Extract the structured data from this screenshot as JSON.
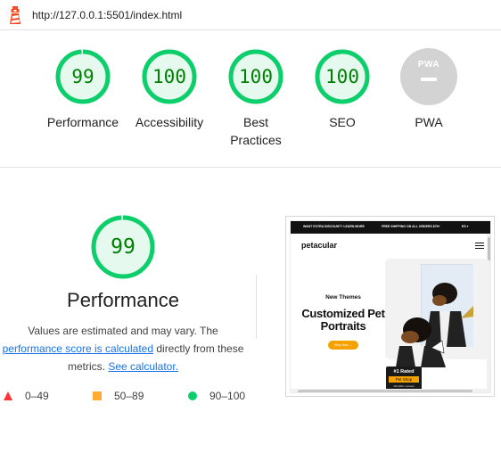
{
  "browser": {
    "url": "http://127.0.0.1:5501/index.html"
  },
  "gauges": [
    {
      "label": "Performance",
      "score": "99",
      "value": 0.99,
      "color": "#0cce6b"
    },
    {
      "label": "Accessibility",
      "score": "100",
      "value": 1.0,
      "color": "#0cce6b"
    },
    {
      "label": "Best Practices",
      "score": "100",
      "value": 1.0,
      "color": "#0cce6b"
    },
    {
      "label": "SEO",
      "score": "100",
      "value": 1.0,
      "color": "#0cce6b"
    },
    {
      "label": "PWA",
      "badge": "PWA",
      "color": "#d3d3d3"
    }
  ],
  "performance": {
    "score": "99",
    "value": 0.99,
    "title": "Performance",
    "desc_prefix": "Values are estimated and may vary. The ",
    "score_link": "performance score is calculated",
    "desc_middle": " directly from these metrics. ",
    "calc_link": "See calculator."
  },
  "legend": [
    {
      "icon": "red-triangle-icon",
      "range": "0–49",
      "color": "#ff3333"
    },
    {
      "icon": "orange-square-icon",
      "range": "50–89",
      "color": "#ffaa33"
    },
    {
      "icon": "green-circle-icon",
      "range": "90–100",
      "color": "#0cce6b"
    }
  ],
  "thumbnail": {
    "promo_left": "WANT EXTRA DISCOUNT? LEARN MORE",
    "promo_center": "FREE SHIPPING ON ALL ORDERS $75+",
    "promo_right": "ES ▾",
    "brand": "petacular",
    "subtitle": "New Themes",
    "title": "Customized Pet Portraits",
    "button": "Shop Now →",
    "badge_title": "#1 Rated",
    "badge_sub": "Pet Shop",
    "badge_reviews": "119,000+ reviews"
  }
}
